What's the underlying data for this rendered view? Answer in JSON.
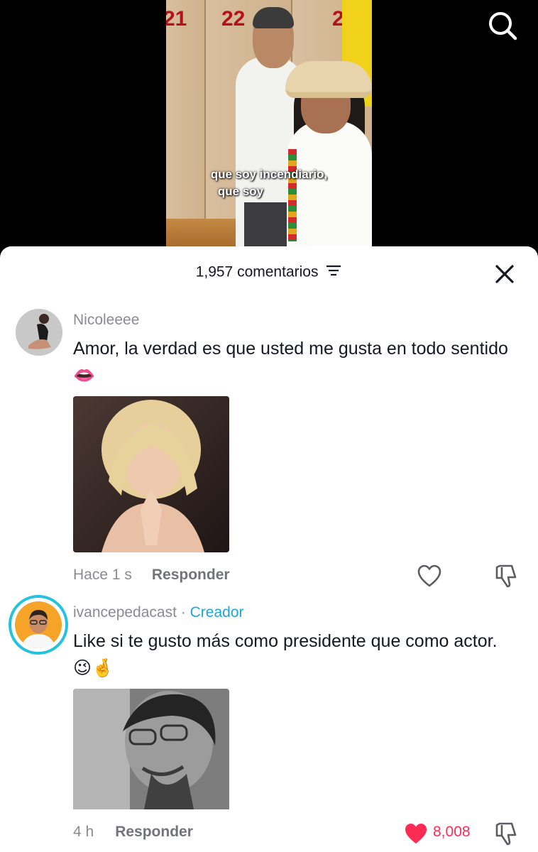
{
  "video": {
    "locker_numbers": [
      "21",
      "22",
      "2"
    ],
    "subtitle_line1": "que soy incendiario,",
    "subtitle_line2": "que soy"
  },
  "top_bar": {
    "search_icon": "search-icon"
  },
  "comments_sheet": {
    "title": "1,957 comentarios",
    "filter_icon": "filter-icon",
    "close_icon": "close-icon",
    "comments": [
      {
        "username": "Nicoleeee",
        "text": "Amor, la verdad es que usted me gusta en todo sentido 👄",
        "gif": "gif-woman-clapping",
        "time": "Hace 1 s",
        "reply_label": "Responder",
        "like_icon": "heart-outline-icon",
        "dislike_icon": "thumbs-down-icon"
      },
      {
        "username": "ivancepedacast",
        "separator": "·",
        "creator_label": "Creador",
        "text": "Like si te gusto más como presidente que como actor. 😉🤞",
        "gif": "gif-smiling-man",
        "time": "4 h",
        "reply_label": "Responder",
        "like_icon": "heart-filled-icon",
        "like_count": "8,008",
        "dislike_icon": "thumbs-down-icon"
      }
    ]
  },
  "colors": {
    "like_red": "#fe2c55",
    "creator_blue": "#20a5d8",
    "text_primary": "#161823",
    "text_secondary": "#8a8b91"
  }
}
